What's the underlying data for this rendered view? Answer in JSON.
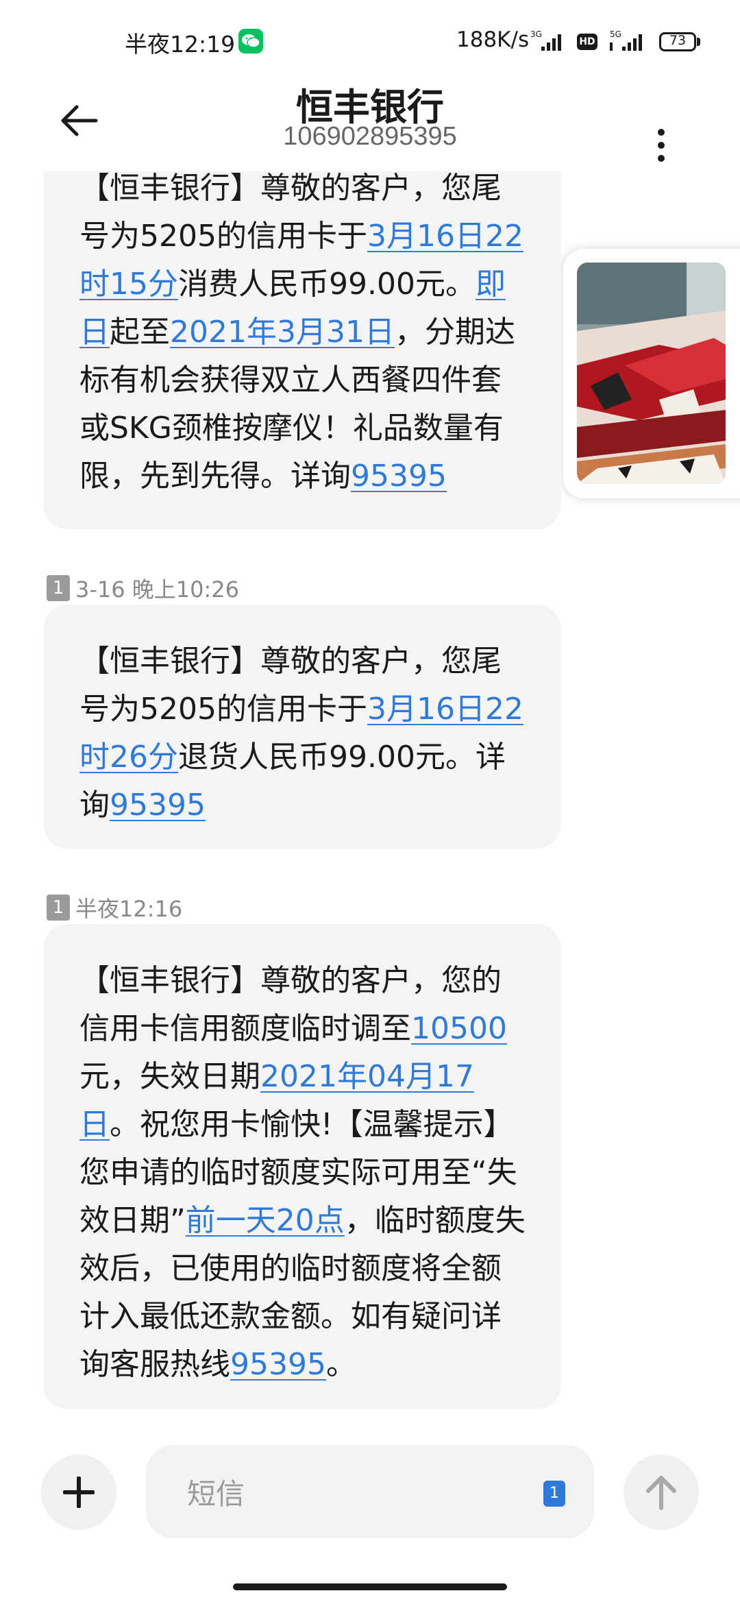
{
  "status_bar": {
    "time": "半夜12:19",
    "net_speed": "188K/s",
    "sig1_label": "3G",
    "hd_label": "HD",
    "sig2_label": "5G",
    "battery": "73",
    "battery_level": 0.73
  },
  "header": {
    "title": "恒丰银行",
    "number": "106902895395"
  },
  "messages": [
    {
      "timestamp": "",
      "segments": [
        {
          "t": "【恒丰银行】尊敬的客户，您尾号为5205的信用卡于"
        },
        {
          "t": "3月16日22时15分",
          "link": true
        },
        {
          "t": "消费人民币99.00元。"
        },
        {
          "t": "即日",
          "link": true
        },
        {
          "t": "起至"
        },
        {
          "t": "2021年3月31日",
          "link": true
        },
        {
          "t": "，分期达标有机会获得双立人西餐四件套或SKG颈椎按摩仪！礼品数量有限，先到先得。详询"
        },
        {
          "t": "95395",
          "link": true
        }
      ]
    },
    {
      "sim": "1",
      "timestamp": "3-16 晚上10:26",
      "segments": [
        {
          "t": "【恒丰银行】尊敬的客户，您尾号为5205的信用卡于"
        },
        {
          "t": "3月16日22时26分",
          "link": true
        },
        {
          "t": "退货人民币99.00元。详询"
        },
        {
          "t": "95395",
          "link": true
        }
      ]
    },
    {
      "sim": "1",
      "timestamp": "半夜12:16",
      "segments": [
        {
          "t": "【恒丰银行】尊敬的客户，您的信用卡信用额度临时调至"
        },
        {
          "t": "10500",
          "link": true
        },
        {
          "t": "元，失效日期"
        },
        {
          "t": "2021年04月17日",
          "link": true
        },
        {
          "t": "。祝您用卡愉快!【温馨提示】您申请的临时额度实际可用至“失效日期”"
        },
        {
          "t": "前一天20点",
          "link": true
        },
        {
          "t": "，临时额度失效后，已使用的临时额度将全额计入最低还款金额。如有疑问详询客服热线"
        },
        {
          "t": "95395",
          "link": true
        },
        {
          "t": "。"
        }
      ]
    }
  ],
  "input": {
    "placeholder": "短信",
    "sim": "1"
  },
  "colors": {
    "link": "#2f7ad6",
    "bubble": "#f4f4f4",
    "wechat": "#07c160"
  },
  "icons": [
    "back-arrow-icon",
    "more-vertical-icon",
    "wechat-icon",
    "signal-icon",
    "battery-icon",
    "plus-icon",
    "send-arrow-icon"
  ]
}
